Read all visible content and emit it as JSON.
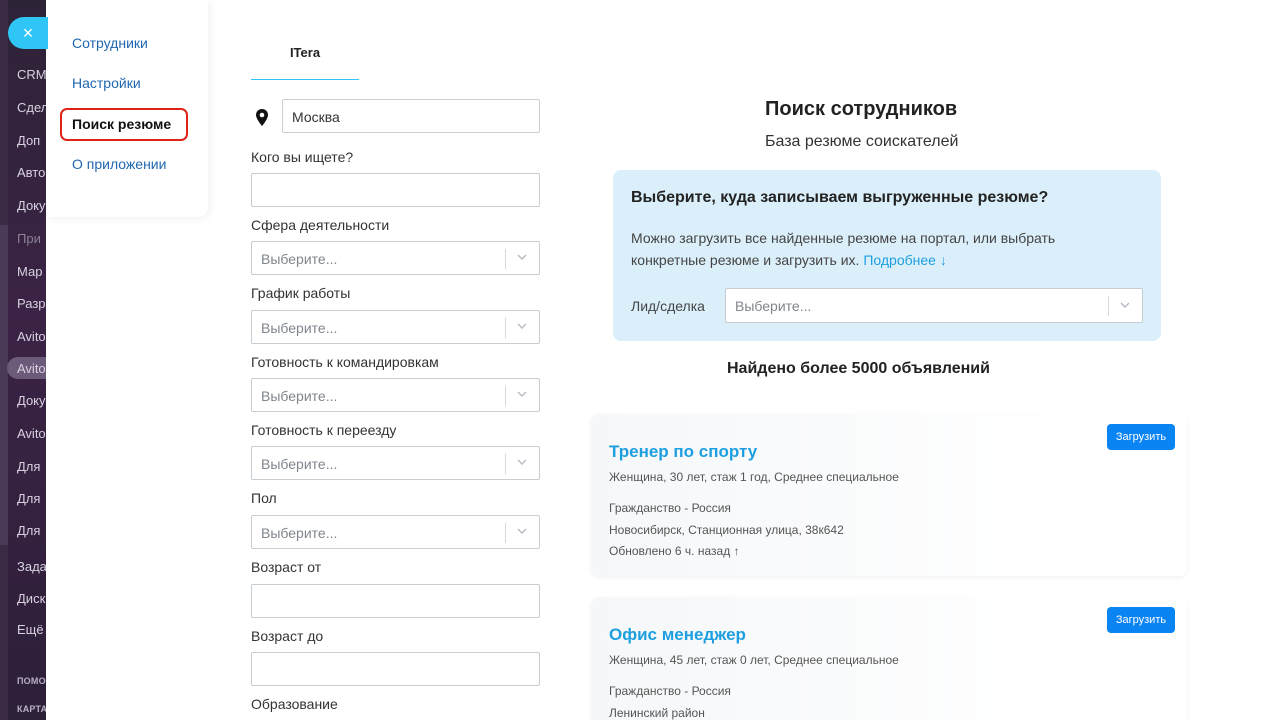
{
  "portal_sidebar": {
    "items": [
      "CRM",
      "Сдел",
      "Доп",
      "Авто",
      "Доку",
      "При",
      "Мар",
      "Разр",
      "Avito",
      "Avito",
      "Доку",
      "Avito",
      "Для",
      "Для",
      "Для",
      "Зада",
      "Диск",
      "Ещё"
    ],
    "footer_items": [
      "ПОМО",
      "КАРТА"
    ]
  },
  "app_menu": {
    "items": [
      {
        "label": "Сотрудники"
      },
      {
        "label": "Настройки"
      },
      {
        "label": "Поиск резюме"
      },
      {
        "label": "О приложении"
      }
    ],
    "active": "Поиск резюме"
  },
  "tab": {
    "label": "ITera"
  },
  "form": {
    "city_value": "Москва",
    "who_label": "Кого вы ищете?",
    "sphere_label": "Сфера деятельности",
    "schedule_label": "График работы",
    "trips_label": "Готовность к командировкам",
    "relocation_label": "Готовность к переезду",
    "gender_label": "Пол",
    "age_from_label": "Возраст от",
    "age_to_label": "Возраст до",
    "education_label": "Образование",
    "select_placeholder": "Выберите..."
  },
  "right": {
    "title": "Поиск сотрудников",
    "subtitle": "База резюме соискателей",
    "info_question": "Выберите, куда записываем выгруженные резюме?",
    "info_text": "Можно загрузить все найденные резюме на портал, или выбрать конкретные резюме и загрузить их.",
    "info_more": "Подробнее ↓",
    "lead_label": "Лид/сделка",
    "lead_placeholder": "Выберите...",
    "found": "Найдено более 5000 объявлений"
  },
  "cards": [
    {
      "title": "Тренер по спорту",
      "meta": "Женщина, 30 лет,  стаж 1 год, Среднее специальное",
      "citizenship": "Гражданство - Россия",
      "address": "Новосибирск, Станционная улица, 38к642",
      "updated": "Обновлено 6 ч. назад ↑",
      "button": "Загрузить"
    },
    {
      "title": "Офис менеджер",
      "meta": "Женщина, 45 лет,  стаж 0 лет, Среднее специальное",
      "citizenship": "Гражданство - Россия",
      "address": "Ленинский район",
      "button": "Загрузить"
    }
  ],
  "colors": {
    "accent": "#2fc6f6",
    "link": "#1d9fe0",
    "button": "#0b84f3",
    "info_bg": "#dbeffa",
    "highlight": "#e0231a"
  }
}
